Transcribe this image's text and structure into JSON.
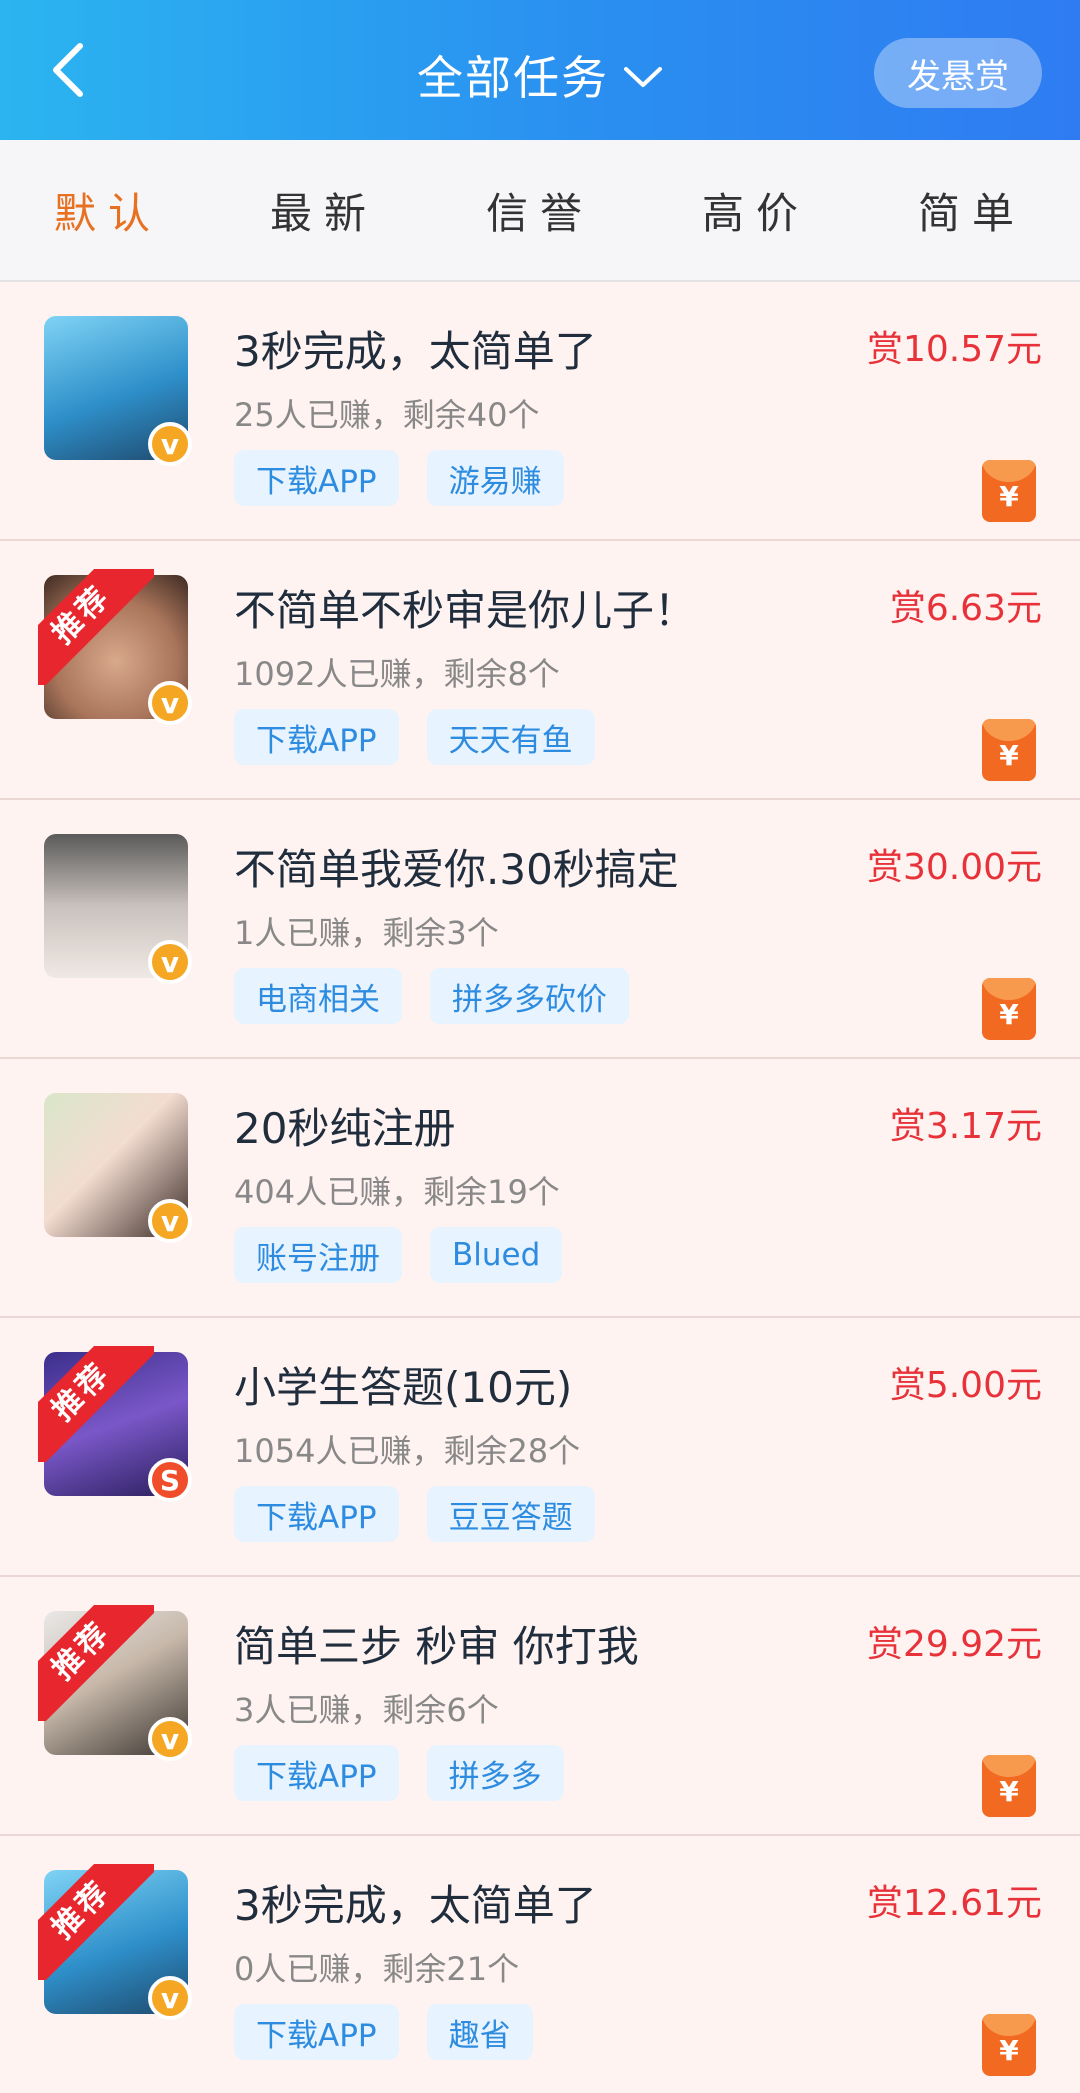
{
  "header": {
    "back_label": "back",
    "title": "全部任务",
    "post_button": "发悬赏"
  },
  "tabs": [
    {
      "label": "默认",
      "active": true
    },
    {
      "label": "最新",
      "active": false
    },
    {
      "label": "信誉",
      "active": false
    },
    {
      "label": "高价",
      "active": false
    },
    {
      "label": "简单",
      "active": false
    }
  ],
  "tasks": [
    {
      "title": "3秒完成，太简单了",
      "meta": "25人已赚，剩余40个",
      "price": "赏10.57元",
      "tags": [
        "下载APP",
        "游易赚"
      ],
      "badge": "v",
      "recommend": false,
      "redpacket": true
    },
    {
      "title": "不简单不秒审是你儿子！",
      "meta": "1092人已赚，剩余8个",
      "price": "赏6.63元",
      "tags": [
        "下载APP",
        "天天有鱼"
      ],
      "badge": "v",
      "recommend": true,
      "redpacket": true
    },
    {
      "title": "不简单我爱你.30秒搞定",
      "meta": "1人已赚，剩余3个",
      "price": "赏30.00元",
      "tags": [
        "电商相关",
        "拼多多砍价"
      ],
      "badge": "v",
      "recommend": false,
      "redpacket": true
    },
    {
      "title": "20秒纯注册",
      "meta": "404人已赚，剩余19个",
      "price": "赏3.17元",
      "tags": [
        "账号注册",
        "Blued"
      ],
      "badge": "v",
      "recommend": false,
      "redpacket": false
    },
    {
      "title": "小学生答题(10元)",
      "meta": "1054人已赚，剩余28个",
      "price": "赏5.00元",
      "tags": [
        "下载APP",
        "豆豆答题"
      ],
      "badge": "S",
      "recommend": true,
      "redpacket": false
    },
    {
      "title": "简单三步 秒审 你打我",
      "meta": "3人已赚，剩余6个",
      "price": "赏29.92元",
      "tags": [
        "下载APP",
        "拼多多"
      ],
      "badge": "v",
      "recommend": true,
      "redpacket": true
    },
    {
      "title": "3秒完成，太简单了",
      "meta": "0人已赚，剩余21个",
      "price": "赏12.61元",
      "tags": [
        "下载APP",
        "趣省"
      ],
      "badge": "v",
      "recommend": true,
      "redpacket": true
    }
  ],
  "recommend_label": "推荐",
  "redpacket_symbol": "¥",
  "colors": {
    "header_start": "#2bb4f0",
    "header_end": "#2f7cf2",
    "active_tab": "#e77021",
    "price": "#e8323a",
    "tag_text": "#2e8ce0",
    "tag_bg": "#e7f3fe",
    "row_bg": "#fff3f1"
  }
}
